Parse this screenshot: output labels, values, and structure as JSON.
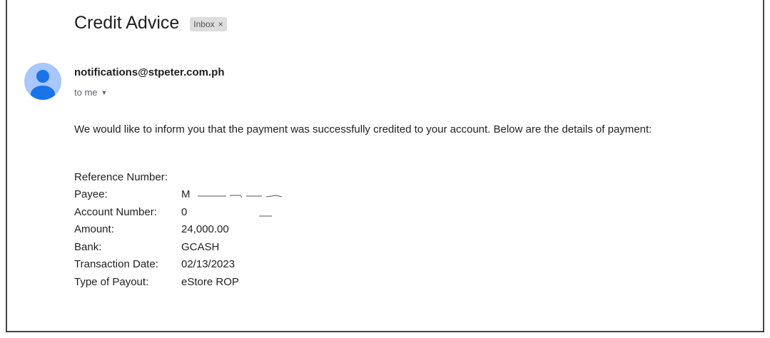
{
  "email": {
    "subject": "Credit Advice",
    "label": "Inbox",
    "label_remove": "×",
    "sender": "notifications@stpeter.com.ph",
    "recipient": "to me",
    "recipient_caret": "▼",
    "body": "We would like to inform you that the payment was successfully credited to your account. Below are the details of payment:",
    "details": [
      {
        "label": "Reference Number:",
        "value": ""
      },
      {
        "label": "Payee:",
        "value": "M"
      },
      {
        "label": "Account Number:",
        "value": "0"
      },
      {
        "label": "Amount:",
        "value": "24,000.00"
      },
      {
        "label": "Bank:",
        "value": "GCASH"
      },
      {
        "label": "Transaction Date:",
        "value": "02/13/2023"
      },
      {
        "label": "Type of Payout:",
        "value": "eStore ROP"
      }
    ]
  },
  "icons": {
    "avatar": "default-person-icon",
    "caret": "chevron-down-icon",
    "remove_label": "close-icon"
  },
  "colors": {
    "avatar_bg": "#a8c7fa",
    "avatar_fg": "#1a73e8",
    "chip_bg": "#dddddd"
  }
}
